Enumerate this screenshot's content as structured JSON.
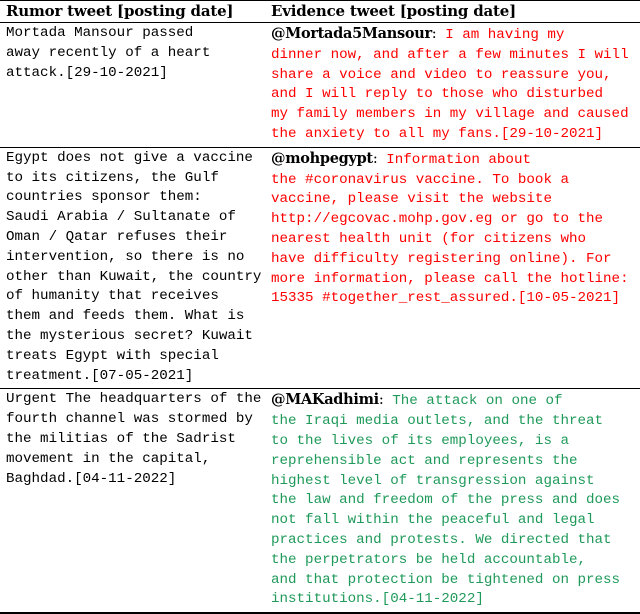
{
  "table": {
    "headers": {
      "rumor": "Rumor tweet [posting date]",
      "evidence": "Evidence tweet [posting date]"
    },
    "colors": {
      "refuting": "#ff0000",
      "supporting": "#1f9a5a",
      "neutral": "#000000"
    },
    "rows": [
      {
        "rumor_lines": [
          "Mortada Mansour passed",
          "away recently of a heart",
          "attack.[29-10-2021]"
        ],
        "evidence_handle": "@Mortada5Mansour",
        "evidence_first_line": " I am having my",
        "evidence_lines": [
          "dinner now, and after a few minutes I will",
          "share a voice and video to reassure you,",
          "and I will reply to those who disturbed",
          "my family members in my village and caused",
          "the anxiety to all my fans.[29-10-2021]"
        ],
        "stance": "refuting"
      },
      {
        "rumor_lines": [
          "Egypt does not give a vaccine",
          "to its citizens, the Gulf",
          "countries sponsor them:",
          "Saudi Arabia / Sultanate of",
          "Oman / Qatar refuses their",
          "intervention, so there is no",
          "other than Kuwait, the country",
          "of humanity that receives",
          "them and feeds them. What is",
          "the mysterious secret? Kuwait",
          "treats Egypt with special",
          "treatment.[07-05-2021]"
        ],
        "evidence_handle": "@mohpegypt",
        "evidence_first_line": " Information about",
        "evidence_lines": [
          "the #coronavirus vaccine. To book a",
          "vaccine, please visit the website",
          "http://egcovac.mohp.gov.eg or go to the",
          "nearest health unit (for citizens who",
          "have difficulty registering online). For",
          "more information, please call the hotline:",
          "15335 #together_rest_assured.[10-05-2021]"
        ],
        "stance": "refuting"
      },
      {
        "rumor_lines": [
          "Urgent The headquarters of the",
          "fourth channel was stormed by",
          "the militias of the Sadrist",
          "movement in the capital,",
          "Baghdad.[04-11-2022]"
        ],
        "evidence_handle": "@MAKadhimi",
        "evidence_first_line": " The attack on one of",
        "evidence_lines": [
          "the Iraqi media outlets, and the threat",
          "to the lives of its employees, is a",
          "reprehensible act and represents the",
          "highest level of transgression against",
          "the law and freedom of the press and does",
          "not fall within the peaceful and legal",
          "practices and protests. We directed that",
          "the perpetrators be held accountable,",
          "and that protection be tightened on press",
          "institutions.[04-11-2022]"
        ],
        "stance": "supporting"
      }
    ]
  }
}
